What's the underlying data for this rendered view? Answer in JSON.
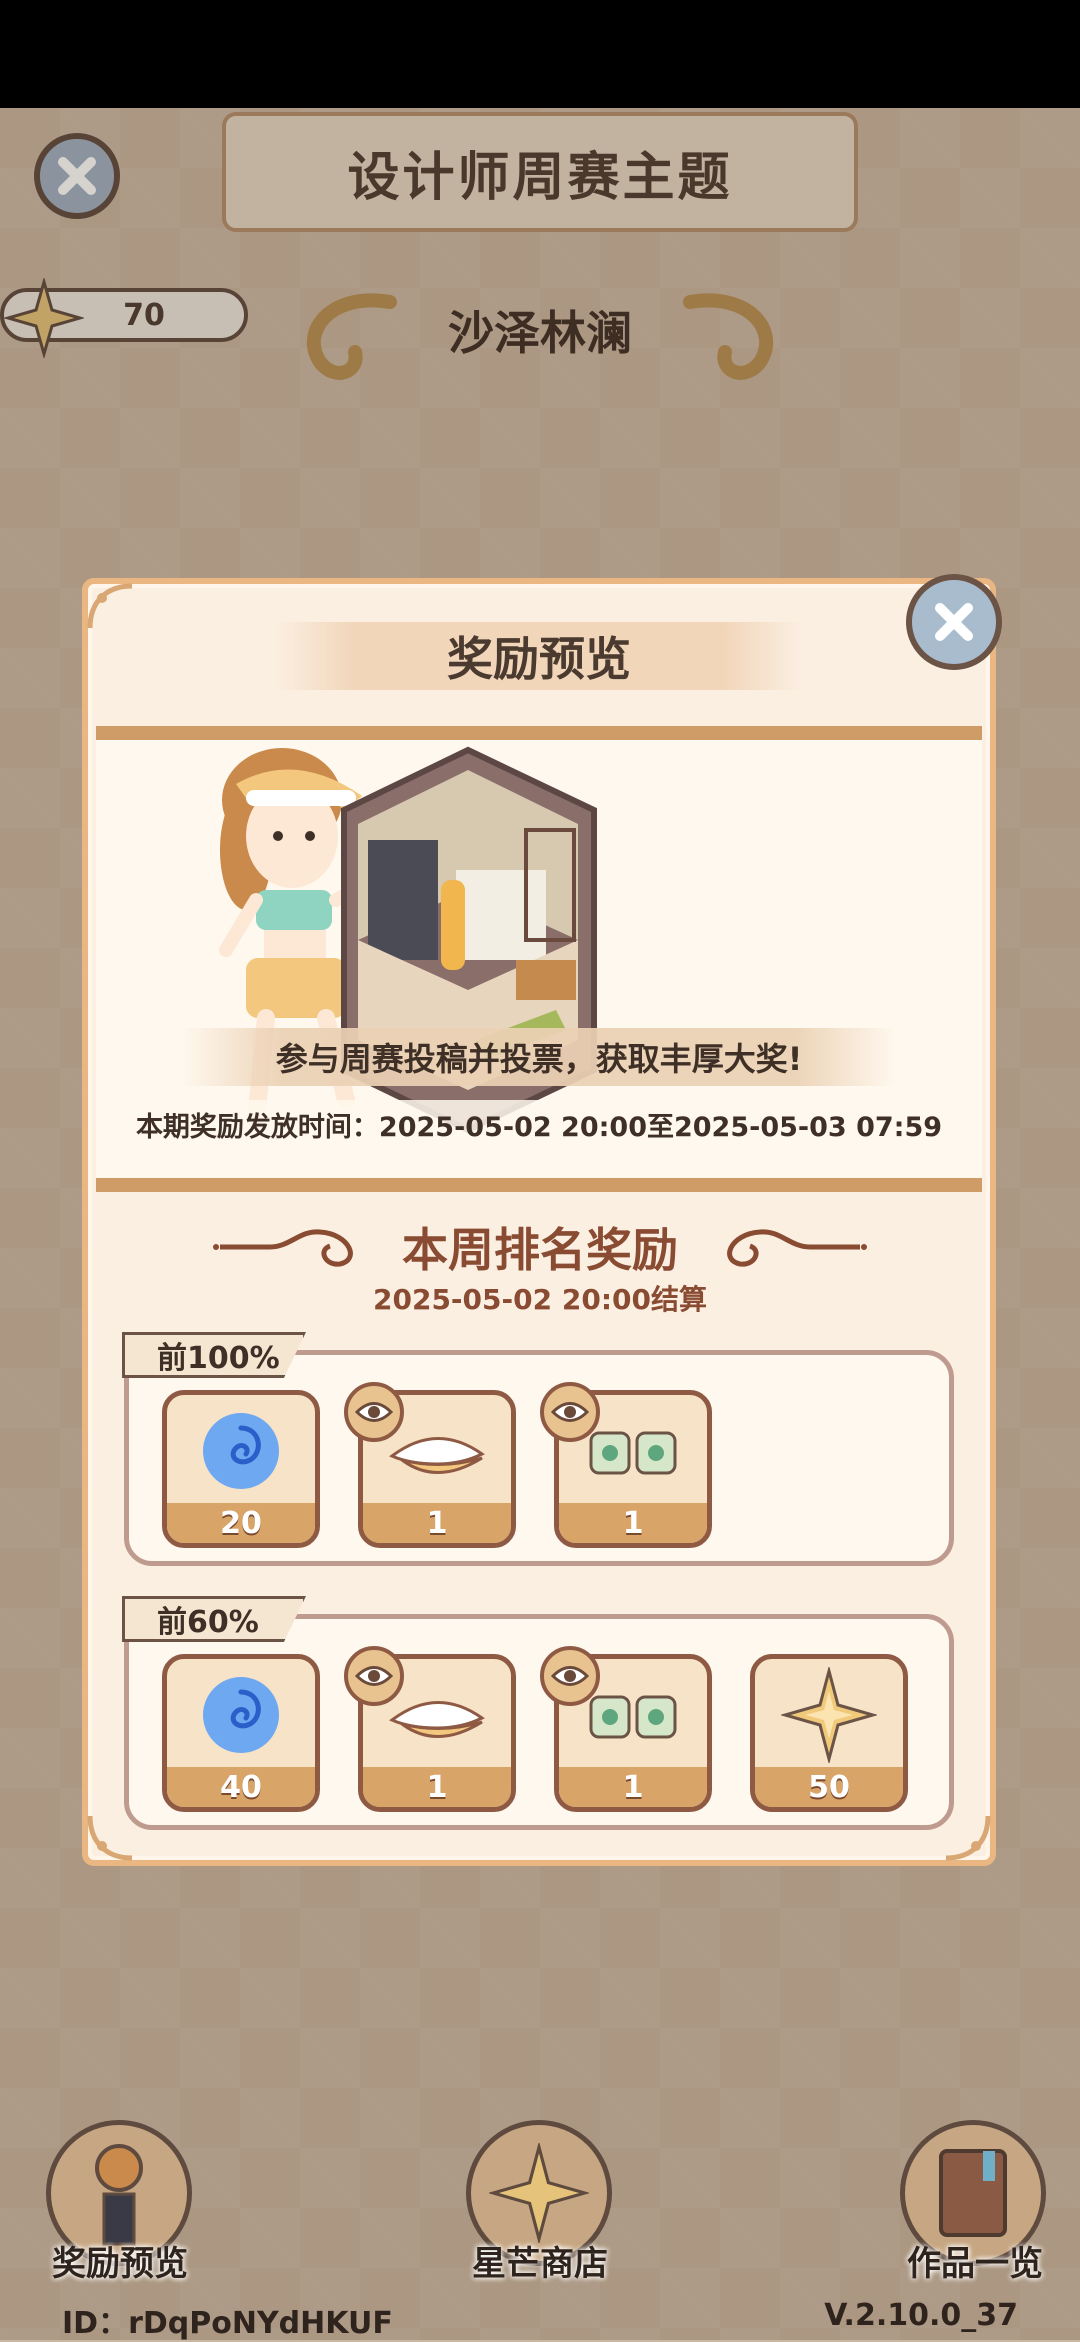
{
  "header": {
    "theme_title": "设计师周赛主题",
    "theme_name": "沙泽林澜",
    "star_count": "70"
  },
  "modal": {
    "title": "奖励预览",
    "banner_message": "参与周赛投稿并投票，获取丰厚大奖!",
    "banner_time": "本期奖励发放时间：2025-05-02 20:00至2025-05-03 07:59",
    "rank_title": "本周排名奖励",
    "rank_date": "2025-05-02 20:00结算",
    "tiers": [
      {
        "label": "前100%",
        "items": [
          {
            "icon": "blue-swirl-icon",
            "qty": "20"
          },
          {
            "icon": "visor-hat-icon",
            "qty": "1"
          },
          {
            "icon": "socks-icon",
            "qty": "1"
          }
        ]
      },
      {
        "label": "前60%",
        "items": [
          {
            "icon": "blue-swirl-icon",
            "qty": "40"
          },
          {
            "icon": "visor-hat-icon",
            "qty": "1"
          },
          {
            "icon": "socks-icon",
            "qty": "1"
          },
          {
            "icon": "star-icon",
            "qty": "50"
          }
        ]
      }
    ]
  },
  "nav": {
    "reward_preview": "奖励预览",
    "star_shop": "星芒商店",
    "works_list": "作品一览"
  },
  "footer": {
    "id": "ID：rDqPoNYdHKUF",
    "version": "V.2.10.0_37"
  },
  "colors": {
    "modal_border": "#eab681",
    "accent_text": "#8a4b33",
    "qty_bar": "#d9a467"
  }
}
